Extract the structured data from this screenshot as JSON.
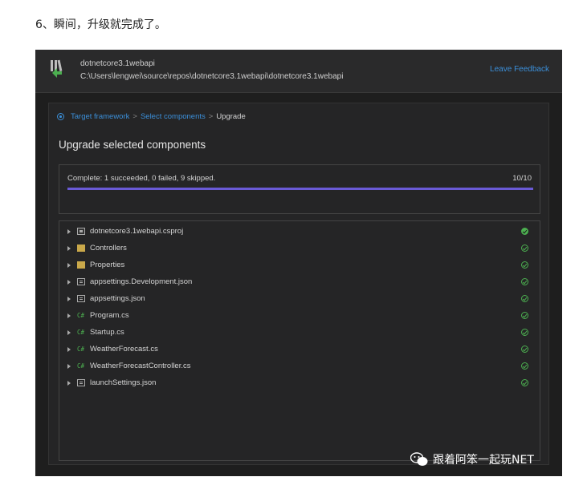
{
  "caption": "6、瞬间，升级就完成了。",
  "header": {
    "project_name": "dotnetcore3.1webapi",
    "project_path": "C:\\Users\\lengwei\\source\\repos\\dotnetcore3.1webapi\\dotnetcore3.1webapi",
    "feedback_link": "Leave Feedback"
  },
  "breadcrumb": {
    "items": [
      "Target framework",
      "Select components",
      "Upgrade"
    ],
    "separator": ">"
  },
  "main": {
    "title": "Upgrade selected components",
    "status_text": "Complete: 1 succeeded, 0 failed, 9 skipped.",
    "progress_count": "10/10",
    "progress_fraction": 1.0,
    "progress_color": "#6a5ad6"
  },
  "files": [
    {
      "label": "dotnetcore3.1webapi.csproj",
      "icon": "project-icon",
      "status": "succeeded"
    },
    {
      "label": "Controllers",
      "icon": "folder-icon",
      "status": "skipped"
    },
    {
      "label": "Properties",
      "icon": "folder-icon",
      "status": "skipped"
    },
    {
      "label": "appsettings.Development.json",
      "icon": "json-file-icon",
      "status": "skipped"
    },
    {
      "label": "appsettings.json",
      "icon": "json-file-icon",
      "status": "skipped"
    },
    {
      "label": "Program.cs",
      "icon": "csharp-file-icon",
      "status": "skipped"
    },
    {
      "label": "Startup.cs",
      "icon": "csharp-file-icon",
      "status": "skipped"
    },
    {
      "label": "WeatherForecast.cs",
      "icon": "csharp-file-icon",
      "status": "skipped"
    },
    {
      "label": "WeatherForecastController.cs",
      "icon": "csharp-file-icon",
      "status": "skipped"
    },
    {
      "label": "launchSettings.json",
      "icon": "json-file-icon",
      "status": "skipped"
    }
  ],
  "csharp_glyph": "C#",
  "watermark": "跟着阿笨一起玩NET",
  "colors": {
    "accent": "#3b8fd9",
    "success": "#4caf50",
    "background": "#1e1e1e"
  }
}
